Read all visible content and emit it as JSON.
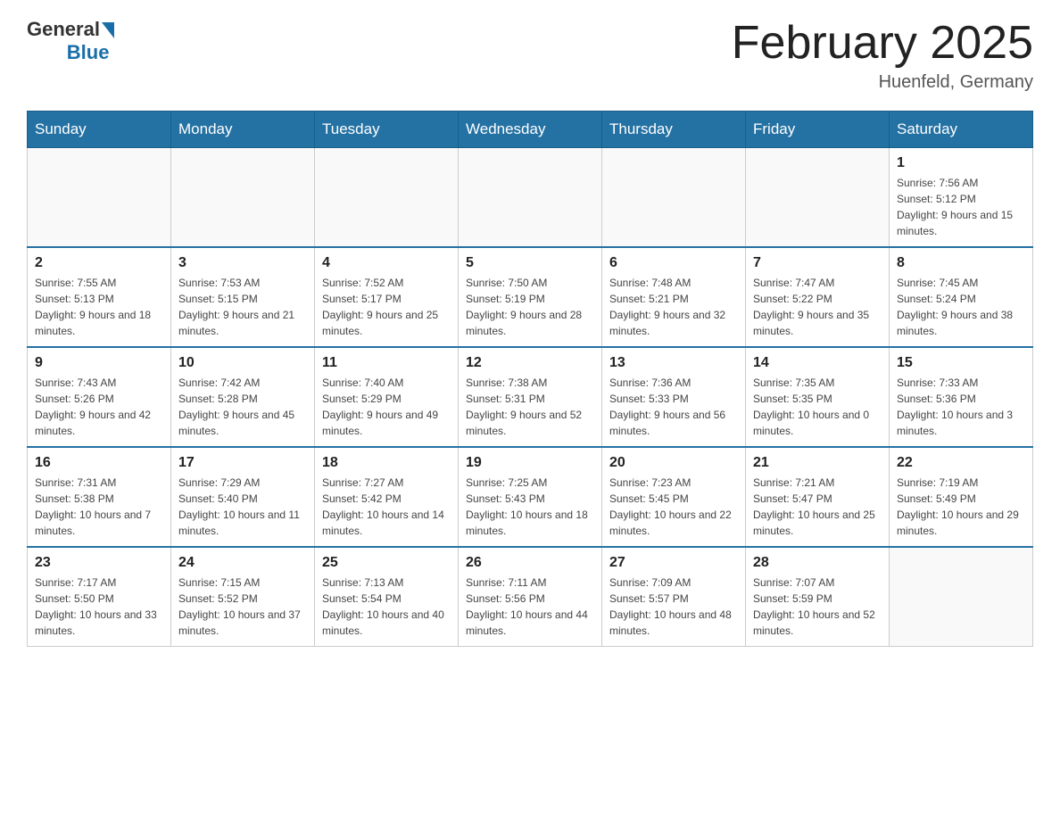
{
  "header": {
    "logo_general": "General",
    "logo_blue": "Blue",
    "month_title": "February 2025",
    "location": "Huenfeld, Germany"
  },
  "weekdays": [
    "Sunday",
    "Monday",
    "Tuesday",
    "Wednesday",
    "Thursday",
    "Friday",
    "Saturday"
  ],
  "weeks": [
    [
      {
        "day": "",
        "info": ""
      },
      {
        "day": "",
        "info": ""
      },
      {
        "day": "",
        "info": ""
      },
      {
        "day": "",
        "info": ""
      },
      {
        "day": "",
        "info": ""
      },
      {
        "day": "",
        "info": ""
      },
      {
        "day": "1",
        "info": "Sunrise: 7:56 AM\nSunset: 5:12 PM\nDaylight: 9 hours and 15 minutes."
      }
    ],
    [
      {
        "day": "2",
        "info": "Sunrise: 7:55 AM\nSunset: 5:13 PM\nDaylight: 9 hours and 18 minutes."
      },
      {
        "day": "3",
        "info": "Sunrise: 7:53 AM\nSunset: 5:15 PM\nDaylight: 9 hours and 21 minutes."
      },
      {
        "day": "4",
        "info": "Sunrise: 7:52 AM\nSunset: 5:17 PM\nDaylight: 9 hours and 25 minutes."
      },
      {
        "day": "5",
        "info": "Sunrise: 7:50 AM\nSunset: 5:19 PM\nDaylight: 9 hours and 28 minutes."
      },
      {
        "day": "6",
        "info": "Sunrise: 7:48 AM\nSunset: 5:21 PM\nDaylight: 9 hours and 32 minutes."
      },
      {
        "day": "7",
        "info": "Sunrise: 7:47 AM\nSunset: 5:22 PM\nDaylight: 9 hours and 35 minutes."
      },
      {
        "day": "8",
        "info": "Sunrise: 7:45 AM\nSunset: 5:24 PM\nDaylight: 9 hours and 38 minutes."
      }
    ],
    [
      {
        "day": "9",
        "info": "Sunrise: 7:43 AM\nSunset: 5:26 PM\nDaylight: 9 hours and 42 minutes."
      },
      {
        "day": "10",
        "info": "Sunrise: 7:42 AM\nSunset: 5:28 PM\nDaylight: 9 hours and 45 minutes."
      },
      {
        "day": "11",
        "info": "Sunrise: 7:40 AM\nSunset: 5:29 PM\nDaylight: 9 hours and 49 minutes."
      },
      {
        "day": "12",
        "info": "Sunrise: 7:38 AM\nSunset: 5:31 PM\nDaylight: 9 hours and 52 minutes."
      },
      {
        "day": "13",
        "info": "Sunrise: 7:36 AM\nSunset: 5:33 PM\nDaylight: 9 hours and 56 minutes."
      },
      {
        "day": "14",
        "info": "Sunrise: 7:35 AM\nSunset: 5:35 PM\nDaylight: 10 hours and 0 minutes."
      },
      {
        "day": "15",
        "info": "Sunrise: 7:33 AM\nSunset: 5:36 PM\nDaylight: 10 hours and 3 minutes."
      }
    ],
    [
      {
        "day": "16",
        "info": "Sunrise: 7:31 AM\nSunset: 5:38 PM\nDaylight: 10 hours and 7 minutes."
      },
      {
        "day": "17",
        "info": "Sunrise: 7:29 AM\nSunset: 5:40 PM\nDaylight: 10 hours and 11 minutes."
      },
      {
        "day": "18",
        "info": "Sunrise: 7:27 AM\nSunset: 5:42 PM\nDaylight: 10 hours and 14 minutes."
      },
      {
        "day": "19",
        "info": "Sunrise: 7:25 AM\nSunset: 5:43 PM\nDaylight: 10 hours and 18 minutes."
      },
      {
        "day": "20",
        "info": "Sunrise: 7:23 AM\nSunset: 5:45 PM\nDaylight: 10 hours and 22 minutes."
      },
      {
        "day": "21",
        "info": "Sunrise: 7:21 AM\nSunset: 5:47 PM\nDaylight: 10 hours and 25 minutes."
      },
      {
        "day": "22",
        "info": "Sunrise: 7:19 AM\nSunset: 5:49 PM\nDaylight: 10 hours and 29 minutes."
      }
    ],
    [
      {
        "day": "23",
        "info": "Sunrise: 7:17 AM\nSunset: 5:50 PM\nDaylight: 10 hours and 33 minutes."
      },
      {
        "day": "24",
        "info": "Sunrise: 7:15 AM\nSunset: 5:52 PM\nDaylight: 10 hours and 37 minutes."
      },
      {
        "day": "25",
        "info": "Sunrise: 7:13 AM\nSunset: 5:54 PM\nDaylight: 10 hours and 40 minutes."
      },
      {
        "day": "26",
        "info": "Sunrise: 7:11 AM\nSunset: 5:56 PM\nDaylight: 10 hours and 44 minutes."
      },
      {
        "day": "27",
        "info": "Sunrise: 7:09 AM\nSunset: 5:57 PM\nDaylight: 10 hours and 48 minutes."
      },
      {
        "day": "28",
        "info": "Sunrise: 7:07 AM\nSunset: 5:59 PM\nDaylight: 10 hours and 52 minutes."
      },
      {
        "day": "",
        "info": ""
      }
    ]
  ]
}
